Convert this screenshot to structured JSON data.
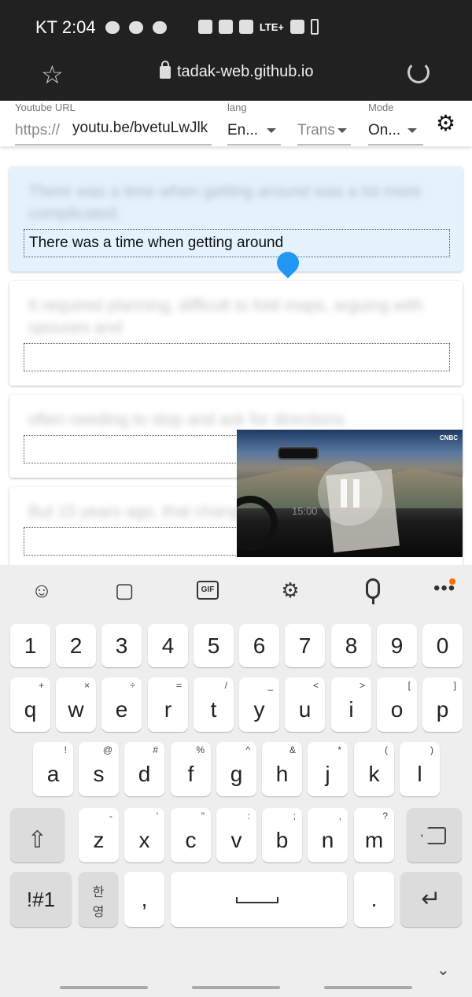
{
  "status_bar": {
    "carrier_time": "KT 2:04",
    "network": "LTE+"
  },
  "browser": {
    "url": "tadak-web.github.io"
  },
  "controls": {
    "url_label": "Youtube URL",
    "url_prefix": "https://",
    "url_value": "youtu.be/bvetuLwJlk",
    "lang_label": "lang",
    "lang_value": "En...",
    "trans_value": "Trans",
    "mode_label": "Mode",
    "mode_value": "On..."
  },
  "cards": [
    {
      "text": "There was a time when getting around was a lot more complicated.",
      "input_value": "There was a time when getting around",
      "active": true
    },
    {
      "text": "It required planning, difficult to fold maps, arguing with spouses and",
      "input_value": "",
      "active": false
    },
    {
      "text": "often needing to stop and ask for directions.",
      "input_value": "",
      "active": false
    },
    {
      "text": "But 15 years ago, that changed.",
      "input_value": "",
      "active": false
    }
  ],
  "video": {
    "timestamp": "15:00",
    "logo": "CNBC"
  },
  "keyboard": {
    "number_row": [
      "1",
      "2",
      "3",
      "4",
      "5",
      "6",
      "7",
      "8",
      "9",
      "0"
    ],
    "row1": [
      {
        "key": "q",
        "hint": "+"
      },
      {
        "key": "w",
        "hint": "×"
      },
      {
        "key": "e",
        "hint": "÷"
      },
      {
        "key": "r",
        "hint": "="
      },
      {
        "key": "t",
        "hint": "/"
      },
      {
        "key": "y",
        "hint": "_"
      },
      {
        "key": "u",
        "hint": "<"
      },
      {
        "key": "i",
        "hint": ">"
      },
      {
        "key": "o",
        "hint": "["
      },
      {
        "key": "p",
        "hint": "]"
      }
    ],
    "row2": [
      {
        "key": "a",
        "hint": "!"
      },
      {
        "key": "s",
        "hint": "@"
      },
      {
        "key": "d",
        "hint": "#"
      },
      {
        "key": "f",
        "hint": "%"
      },
      {
        "key": "g",
        "hint": "^"
      },
      {
        "key": "h",
        "hint": "&"
      },
      {
        "key": "j",
        "hint": "*"
      },
      {
        "key": "k",
        "hint": "("
      },
      {
        "key": "l",
        "hint": ")"
      }
    ],
    "row3": [
      {
        "key": "z",
        "hint": "-"
      },
      {
        "key": "x",
        "hint": "'"
      },
      {
        "key": "c",
        "hint": "\""
      },
      {
        "key": "v",
        "hint": ":"
      },
      {
        "key": "b",
        "hint": ";"
      },
      {
        "key": "n",
        "hint": ","
      },
      {
        "key": "m",
        "hint": "?"
      }
    ],
    "symbols_key": "!#1",
    "lang_key_top": "한",
    "lang_key_bottom": "영",
    "comma_key": ",",
    "period_key": ".",
    "toolbar_gif": "GIF"
  }
}
